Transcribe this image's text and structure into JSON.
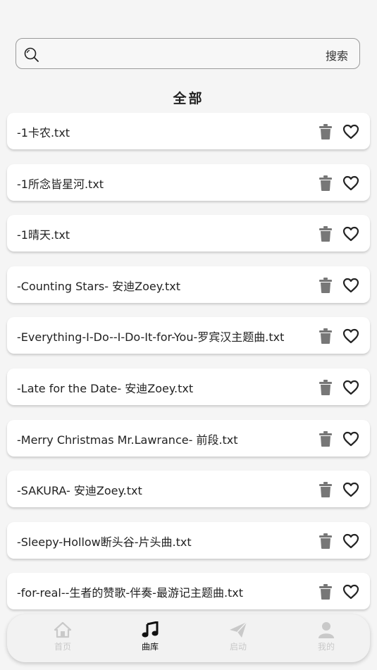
{
  "search": {
    "placeholder": "",
    "value": "",
    "button_label": "搜索"
  },
  "section_title": "全部",
  "songs": [
    "-1卡农.txt",
    "-1所念皆星河.txt",
    "-1晴天.txt",
    "-Counting Stars- 安迪Zoey.txt",
    "-Everything-I-Do--I-Do-It-for-You-罗宾汉主题曲.txt",
    "-Late for the Date- 安迪Zoey.txt",
    "-Merry Christmas Mr.Lawrance- 前段.txt",
    "-SAKURA- 安迪Zoey.txt",
    "-Sleepy-Hollow断头谷-片头曲.txt",
    "-for-real--生者的赞歌-伴奏-最游记主题曲.txt"
  ],
  "item_icons": {
    "delete": "trash-icon",
    "favorite": "heart-icon"
  },
  "nav": {
    "items": [
      {
        "label": "首页",
        "icon": "home-icon",
        "active": false
      },
      {
        "label": "曲库",
        "icon": "music-note-icon",
        "active": true
      },
      {
        "label": "启动",
        "icon": "send-icon",
        "active": false
      },
      {
        "label": "我的",
        "icon": "user-icon",
        "active": false
      }
    ]
  },
  "colors": {
    "active": "#111111",
    "inactive": "#c9c9c9",
    "icon_gray": "#777777"
  }
}
